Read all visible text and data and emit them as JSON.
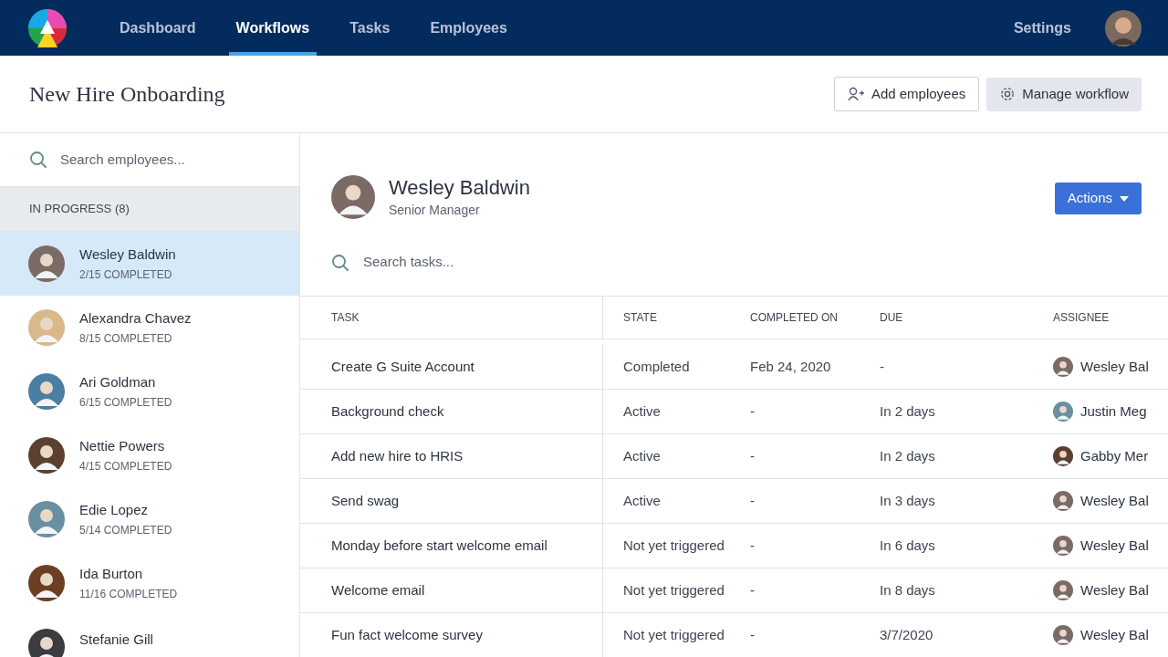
{
  "nav": {
    "tabs": [
      {
        "label": "Dashboard",
        "selected": false
      },
      {
        "label": "Workflows",
        "selected": true
      },
      {
        "label": "Tasks",
        "selected": false
      },
      {
        "label": "Employees",
        "selected": false
      }
    ],
    "settings": "Settings"
  },
  "header": {
    "title": "New Hire Onboarding",
    "buttons": [
      {
        "kind": "add",
        "label": "Add employees"
      },
      {
        "kind": "manage",
        "label": "Manage workflow"
      }
    ]
  },
  "sidebar": {
    "search": {
      "placeholder": "Search employees..."
    },
    "group": "IN PROGRESS (8)",
    "items": [
      {
        "name": "Wesley Baldwin",
        "progress": "2/15 COMPLETED",
        "selected": true
      },
      {
        "name": "Alexandra Chavez",
        "progress": "8/15 COMPLETED",
        "selected": false
      },
      {
        "name": "Ari Goldman",
        "progress": "6/15 COMPLETED",
        "selected": false
      },
      {
        "name": "Nettie Powers",
        "progress": "4/15 COMPLETED",
        "selected": false
      },
      {
        "name": "Edie Lopez",
        "progress": "5/14 COMPLETED",
        "selected": false
      },
      {
        "name": "Ida Burton",
        "progress": "11/16 COMPLETED",
        "selected": false
      },
      {
        "name": "Stefanie Gill",
        "selected": false
      }
    ]
  },
  "profile": {
    "name": "Wesley Baldwin",
    "role": "Senior Manager",
    "actions": "Actions"
  },
  "task_search": {
    "placeholder": "Search tasks..."
  },
  "table": {
    "columns": [
      "TASK",
      "STATE",
      "COMPLETED ON",
      "DUE",
      "ASSIGNEE"
    ],
    "rows": [
      [
        "Create G Suite Account",
        "Completed",
        "Feb 24, 2020",
        "-",
        "Wesley Bal"
      ],
      [
        "Background check",
        "Active",
        "-",
        "In 2 days",
        "Justin Meg"
      ],
      [
        "Add new hire to HRIS",
        "Active",
        "-",
        "In 2 days",
        "Gabby Mer"
      ],
      [
        "Send swag",
        "Active",
        "-",
        "In 3 days",
        "Wesley Bal"
      ],
      [
        "Monday before start welcome email",
        "Not yet triggered",
        "-",
        "In 6 days",
        "Wesley Bal"
      ],
      [
        "Welcome email",
        "Not yet triggered",
        "-",
        "In 8 days",
        "Wesley Bal"
      ],
      [
        "Fun fact welcome survey",
        "Not yet triggered",
        "-",
        "3/7/2020",
        "Wesley Bal"
      ]
    ]
  }
}
